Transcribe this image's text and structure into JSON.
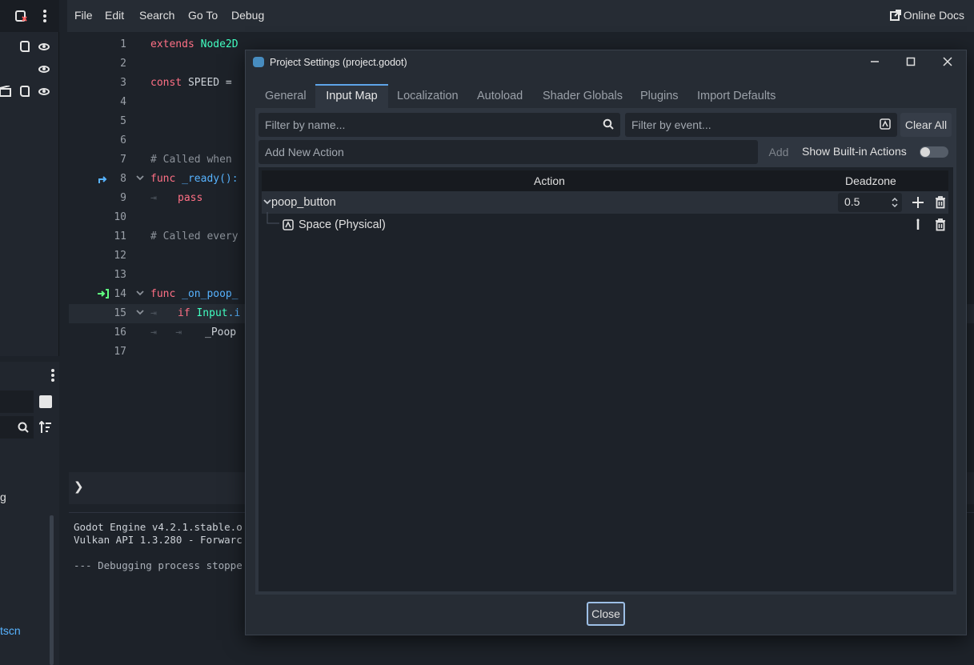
{
  "editor": {
    "menu": [
      "File",
      "Edit",
      "Search",
      "Go To",
      "Debug"
    ],
    "online_docs": "Online Docs",
    "line_numbers": [
      "1",
      "2",
      "3",
      "4",
      "5",
      "6",
      "7",
      "8",
      "9",
      "10",
      "11",
      "12",
      "13",
      "14",
      "15",
      "16",
      "17"
    ],
    "code": {
      "l1_kw": "extends",
      "l1_ty": "Node2D",
      "l3_kw": "const",
      "l3_rest": "SPEED =",
      "l7": "# Called when",
      "l8_kw": "func",
      "l8_rest": "_ready():",
      "l9": "pass",
      "l11": "# Called every",
      "l14_kw": "func",
      "l14_rest": "_on_poop_",
      "l15_kw": "if",
      "l15_ty": "Input",
      "l15_rest": ".i",
      "l16": "_Poop"
    },
    "console_prompt": "❯",
    "console_lines": [
      "Godot Engine v4.2.1.stable.o",
      "Vulkan API 1.3.280 - Forwarc",
      "",
      "--- Debugging process stoppe"
    ],
    "left_labels": {
      "g": "g",
      "tscn": "tscn"
    }
  },
  "dialog": {
    "title": "Project Settings (project.godot)",
    "tabs": [
      "General",
      "Input Map",
      "Localization",
      "Autoload",
      "Shader Globals",
      "Plugins",
      "Import Defaults"
    ],
    "active_tab": "Input Map",
    "filter_name_placeholder": "Filter by name...",
    "filter_event_placeholder": "Filter by event...",
    "clear_all": "Clear All",
    "add_action_placeholder": "Add New Action",
    "add_label": "Add",
    "show_builtin_label": "Show Built-in Actions",
    "show_builtin_enabled": false,
    "columns": {
      "action": "Action",
      "deadzone": "Deadzone"
    },
    "actions": [
      {
        "name": "poop_button",
        "deadzone": "0.5",
        "events": [
          "Space (Physical)"
        ]
      }
    ],
    "close_label": "Close"
  },
  "colors": {
    "accent": "#5ea4e8",
    "keyword": "#ff7085",
    "type": "#42ffc2",
    "comment": "#8b9199"
  }
}
